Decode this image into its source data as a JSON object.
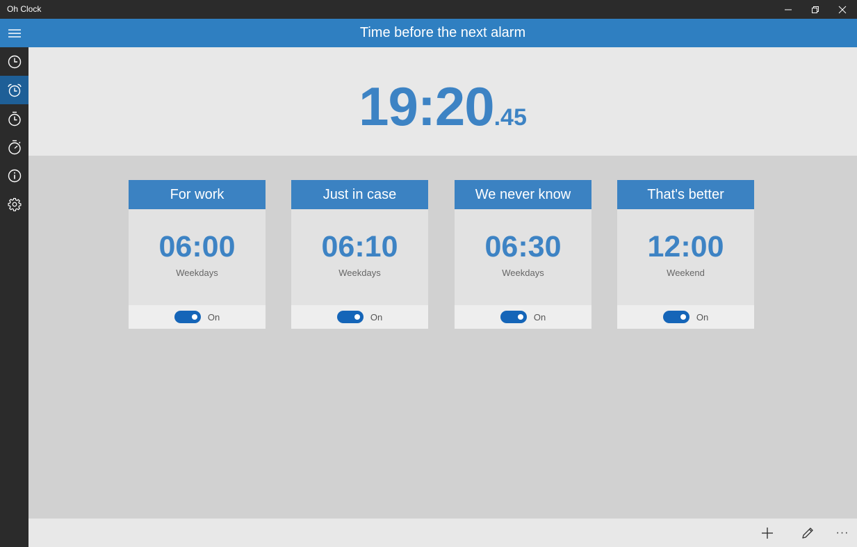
{
  "window": {
    "title": "Oh Clock"
  },
  "sidebar": {
    "items": [
      {
        "icon": "hamburger-menu-icon"
      },
      {
        "icon": "clock-icon"
      },
      {
        "icon": "alarm-clock-icon",
        "active": true
      },
      {
        "icon": "timer-icon"
      },
      {
        "icon": "stopwatch-icon"
      },
      {
        "icon": "info-icon"
      },
      {
        "icon": "gear-icon"
      }
    ]
  },
  "header": {
    "title": "Time before the next alarm"
  },
  "countdown": {
    "main": "19:20",
    "fraction": ".45"
  },
  "alarms": [
    {
      "name": "For work",
      "time": "06:00",
      "days": "Weekdays",
      "state": "On"
    },
    {
      "name": "Just in case",
      "time": "06:10",
      "days": "Weekdays",
      "state": "On"
    },
    {
      "name": "We never know",
      "time": "06:30",
      "days": "Weekdays",
      "state": "On"
    },
    {
      "name": "That's better",
      "time": "12:00",
      "days": "Weekend",
      "state": "On"
    }
  ],
  "commandbar": {
    "more_label": "···"
  },
  "colors": {
    "accent": "#2f7fc1",
    "active_nav": "#1e5f97",
    "time_text": "#3d83c4",
    "toggle_on": "#1565b8"
  }
}
